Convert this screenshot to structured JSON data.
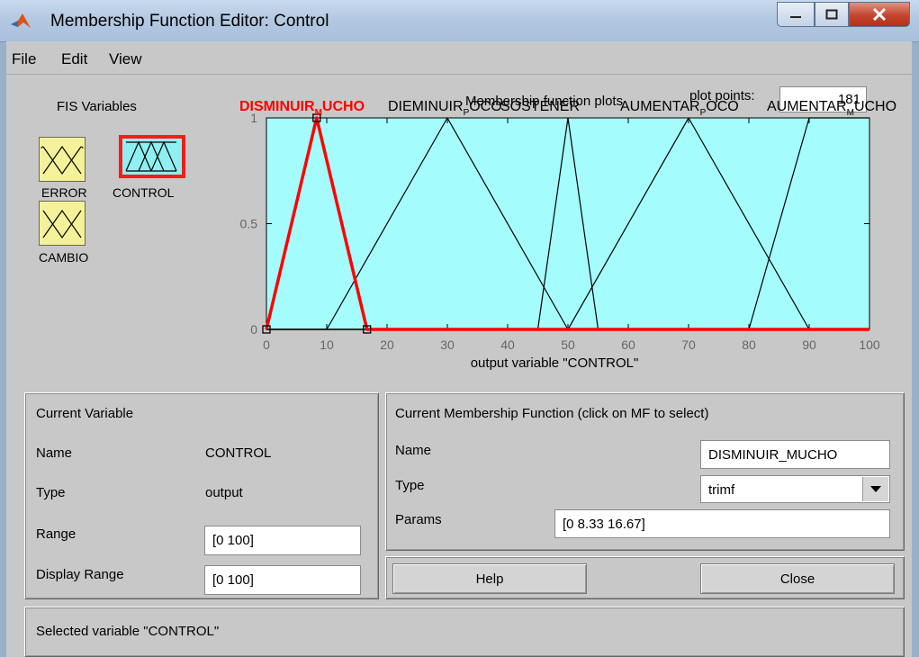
{
  "window": {
    "title": "Membership Function Editor: Control"
  },
  "menu": [
    {
      "label": "File"
    },
    {
      "label": "Edit"
    },
    {
      "label": "View"
    }
  ],
  "fis": {
    "heading": "FIS Variables",
    "variables": [
      {
        "name": "ERROR",
        "selected": false
      },
      {
        "name": "CONTROL",
        "selected": true
      },
      {
        "name": "CAMBIO",
        "selected": false
      }
    ]
  },
  "plot_header": {
    "title": "Membership function plots",
    "points_label": "plot points:",
    "points_value": "181"
  },
  "chart_data": {
    "type": "line",
    "xlabel": "output variable \"CONTROL\"",
    "xlim": [
      0,
      100
    ],
    "ylim": [
      0,
      1
    ],
    "x_ticks": [
      "0",
      "10",
      "20",
      "30",
      "40",
      "50",
      "60",
      "70",
      "80",
      "90",
      "100"
    ],
    "y_ticks": [
      "0",
      "0.5",
      "1"
    ],
    "selected_color": "#ff0000",
    "series": [
      {
        "name": "DISMINUIR_MUCHO",
        "label_main": "DISMINUIR",
        "label_sub": "M",
        "label_tail": "UCHO",
        "points": [
          [
            0,
            0
          ],
          [
            8.33,
            1
          ],
          [
            16.67,
            0
          ],
          [
            100,
            0
          ]
        ],
        "selected": true
      },
      {
        "name": "DIEMINUIR_POCO",
        "label_main": "DIEMINUIR",
        "label_sub": "P",
        "label_tail": "OCO",
        "points": [
          [
            0,
            0
          ],
          [
            10,
            0
          ],
          [
            30,
            1
          ],
          [
            50,
            0
          ],
          [
            100,
            0
          ]
        ],
        "selected": false
      },
      {
        "name": "SOSTENER",
        "label_main": "SOSTENER",
        "label_sub": "",
        "label_tail": "",
        "points": [
          [
            0,
            0
          ],
          [
            45,
            0
          ],
          [
            50,
            1
          ],
          [
            55,
            0
          ],
          [
            100,
            0
          ]
        ],
        "selected": false
      },
      {
        "name": "AUMENTAR_POCO",
        "label_main": "AUMENTAR",
        "label_sub": "P",
        "label_tail": "OCO",
        "points": [
          [
            0,
            0
          ],
          [
            50,
            0
          ],
          [
            70,
            1
          ],
          [
            90,
            0
          ],
          [
            100,
            0
          ]
        ],
        "selected": false
      },
      {
        "name": "AUMENTAR_MUCHO",
        "label_main": "AUMENTAR",
        "label_sub": "M",
        "label_tail": "UCHO",
        "points": [
          [
            0,
            0
          ],
          [
            80,
            0
          ],
          [
            90,
            1
          ],
          [
            100,
            1
          ]
        ],
        "selected": false
      }
    ]
  },
  "current_variable": {
    "heading": "Current Variable",
    "name_label": "Name",
    "name_value": "CONTROL",
    "type_label": "Type",
    "type_value": "output",
    "range_label": "Range",
    "range_value": "[0 100]",
    "display_range_label": "Display Range",
    "display_range_value": "[0 100]"
  },
  "current_mf": {
    "heading": "Current Membership Function (click on MF to select)",
    "name_label": "Name",
    "name_value": "DISMINUIR_MUCHO",
    "type_label": "Type",
    "type_value": "trimf",
    "params_label": "Params",
    "params_value": "[0 8.33 16.67]"
  },
  "buttons": {
    "help": "Help",
    "close": "Close"
  },
  "status": "Selected variable \"CONTROL\""
}
